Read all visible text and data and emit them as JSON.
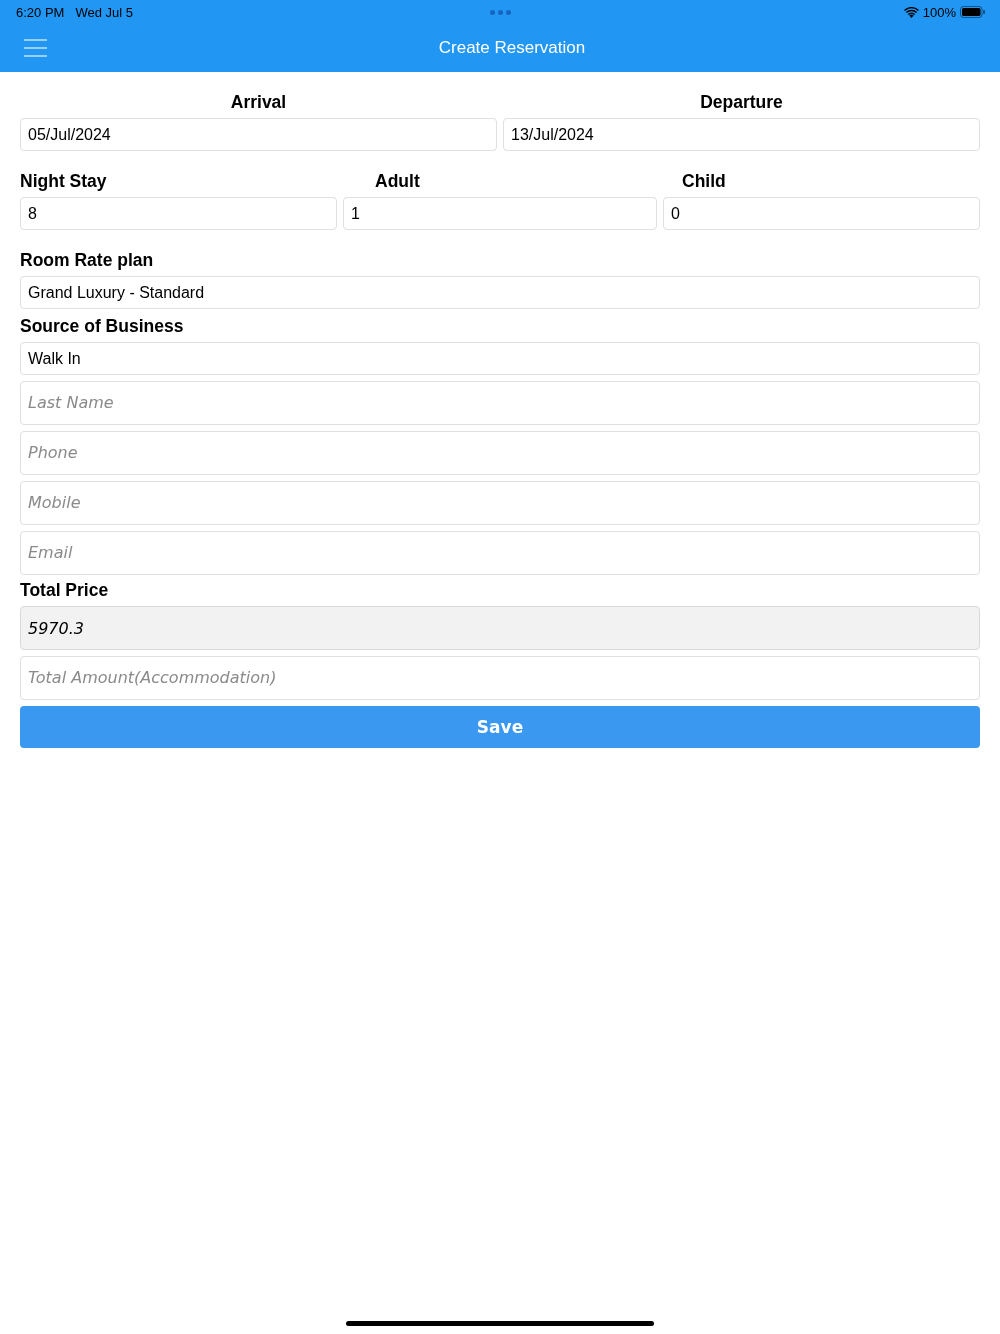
{
  "status_bar": {
    "time": "6:20 PM",
    "date": "Wed Jul 5",
    "battery": "100%"
  },
  "header": {
    "title": "Create Reservation"
  },
  "date_fields": [
    {
      "label": "Arrival",
      "value": "05/Jul/2024"
    },
    {
      "label": "Departure",
      "value": "13/Jul/2024"
    }
  ],
  "count_fields": [
    {
      "label": "Night Stay",
      "value": "8"
    },
    {
      "label": "Adult",
      "value": "1"
    },
    {
      "label": "Child",
      "value": "0"
    }
  ],
  "room_rate_plan": {
    "label": "Room Rate plan",
    "value": "Grand Luxury - Standard"
  },
  "source_of_business": {
    "label": "Source of Business",
    "value": "Walk In"
  },
  "contact_fields": [
    {
      "placeholder": "Last Name"
    },
    {
      "placeholder": "Phone"
    },
    {
      "placeholder": "Mobile"
    },
    {
      "placeholder": "Email"
    }
  ],
  "total_price": {
    "label": "Total Price",
    "value": "5970.3",
    "disabled": true
  },
  "total_amount": {
    "placeholder": "Total Amount(Accommodation)"
  },
  "save_button": {
    "label": "Save"
  }
}
